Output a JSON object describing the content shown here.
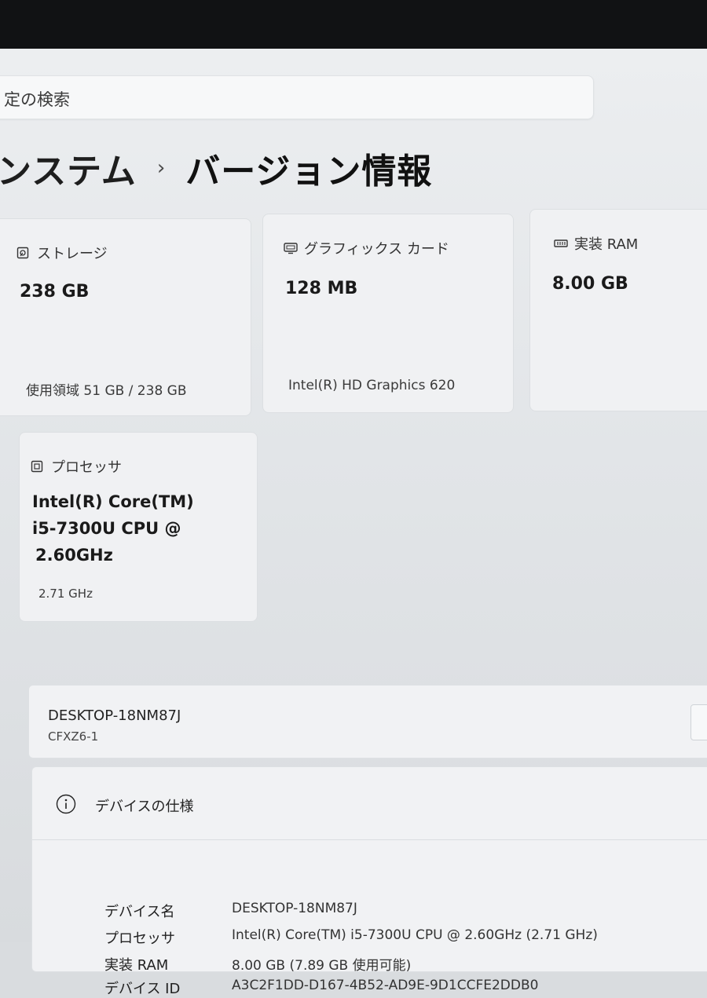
{
  "search": {
    "placeholder": "定の検索"
  },
  "breadcrumb": {
    "parent": "ンステム",
    "separator": "›",
    "current": "バージョン情報"
  },
  "cards": {
    "storage": {
      "label": "ストレージ",
      "value": "238 GB",
      "detail": "使用領域 51 GB / 238 GB",
      "icon": "storage-icon"
    },
    "graphics": {
      "label": "グラフィックス カード",
      "value": "128 MB",
      "detail": "Intel(R) HD Graphics 620",
      "icon": "monitor-icon"
    },
    "ram": {
      "label": "実装 RAM",
      "value": "8.00 GB",
      "icon": "memory-icon"
    },
    "processor": {
      "label": "プロセッサ",
      "value_lines": [
        "Intel(R) Core(TM)",
        "i5-7300U CPU @",
        "2.60GHz"
      ],
      "detail": "2.71 GHz",
      "icon": "cpu-icon"
    }
  },
  "device": {
    "name": "DESKTOP-18NM87J",
    "model": "CFXZ6-1"
  },
  "specs": {
    "title": "デバイスの仕様",
    "icon": "info-icon",
    "rows": [
      {
        "label": "デバイス名",
        "value": "DESKTOP-18NM87J"
      },
      {
        "label": "プロセッサ",
        "value": "Intel(R) Core(TM) i5-7300U CPU @ 2.60GHz (2.71 GHz)"
      },
      {
        "label": "実装 RAM",
        "value": "8.00 GB (7.89 GB 使用可能)"
      },
      {
        "label": "デバイス ID",
        "value": "A3C2F1DD-D167-4B52-AD9E-9D1CCFE2DDB0"
      }
    ]
  }
}
